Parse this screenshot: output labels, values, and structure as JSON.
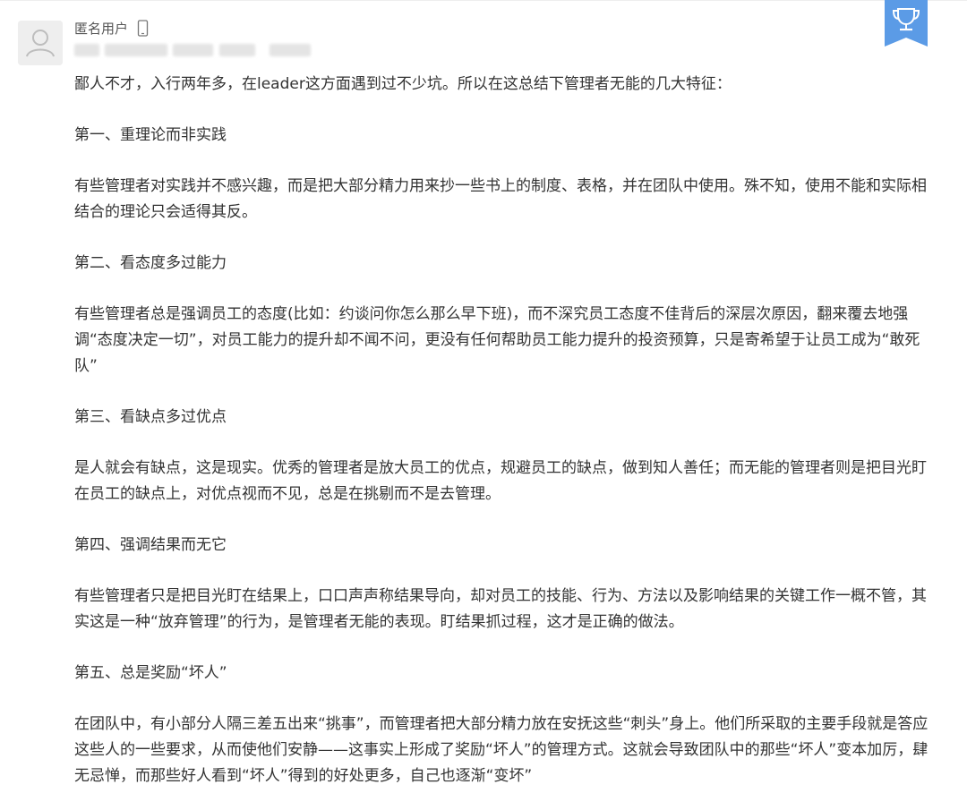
{
  "user": {
    "name": "匿名用户"
  },
  "colors": {
    "badge": "#5b9be6",
    "avatar_bg": "#eeeeee",
    "text": "#333333"
  },
  "icons": {
    "avatar": "default-user-avatar-icon",
    "device": "phone-icon",
    "badge": "trophy-icon"
  },
  "post": {
    "intro": "鄙人不才，入行两年多，在leader这方面遇到过不少坑。所以在这总结下管理者无能的几大特征：",
    "sections": [
      {
        "heading": "第一、重理论而非实践",
        "body": "有些管理者对实践并不感兴趣，而是把大部分精力用来抄一些书上的制度、表格，并在团队中使用。殊不知，使用不能和实际相结合的理论只会适得其反。"
      },
      {
        "heading": "第二、看态度多过能力",
        "body": "有些管理者总是强调员工的态度(比如：约谈问你怎么那么早下班)，而不深究员工态度不佳背后的深层次原因，翻来覆去地强调“态度决定一切”，对员工能力的提升却不闻不问，更没有任何帮助员工能力提升的投资预算，只是寄希望于让员工成为“敢死队”"
      },
      {
        "heading": "第三、看缺点多过优点",
        "body": "是人就会有缺点，这是现实。优秀的管理者是放大员工的优点，规避员工的缺点，做到知人善任；而无能的管理者则是把目光盯在员工的缺点上，对优点视而不见，总是在挑剔而不是去管理。"
      },
      {
        "heading": "第四、强调结果而无它",
        "body": "有些管理者只是把目光盯在结果上，口口声声称结果导向，却对员工的技能、行为、方法以及影响结果的关键工作一概不管，其实这是一种“放弃管理”的行为，是管理者无能的表现。盯结果抓过程，这才是正确的做法。"
      },
      {
        "heading": "第五、总是奖励“坏人”",
        "body": "在团队中，有小部分人隔三差五出来“挑事”，而管理者把大部分精力放在安抚这些“刺头”身上。他们所采取的主要手段就是答应这些人的一些要求，从而使他们安静——这事实上形成了奖励“坏人”的管理方式。这就会导致团队中的那些“坏人”变本加厉，肆无忌惮，而那些好人看到“坏人”得到的好处更多，自己也逐渐“变坏”"
      }
    ]
  }
}
